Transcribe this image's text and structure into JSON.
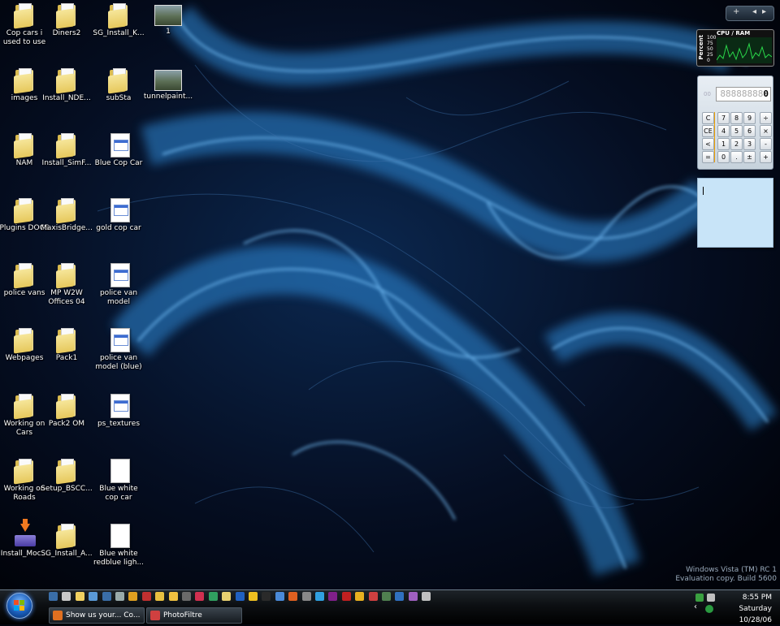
{
  "desktop": {
    "icons": [
      {
        "label": "Cop cars i used to use",
        "type": "folder"
      },
      {
        "label": "Diners2",
        "type": "folder"
      },
      {
        "label": "SG_Install_K...",
        "type": "folder"
      },
      {
        "label": "1",
        "type": "thumb"
      },
      {
        "label": "images",
        "type": "folder"
      },
      {
        "label": "Install_NDE...",
        "type": "folder"
      },
      {
        "label": "subSta",
        "type": "folder"
      },
      {
        "label": "tunnelpaint...",
        "type": "thumb"
      },
      {
        "label": "NAM",
        "type": "folder"
      },
      {
        "label": "Install_SimF...",
        "type": "folder"
      },
      {
        "label": "Blue Cop Car",
        "type": "doc"
      },
      {
        "label": "Plugins DOCS",
        "type": "folder"
      },
      {
        "label": "MaxisBridge...",
        "type": "folder"
      },
      {
        "label": "gold cop car",
        "type": "doc"
      },
      {
        "label": "police vans",
        "type": "folder"
      },
      {
        "label": "MP W2W Offices 04",
        "type": "folder"
      },
      {
        "label": "police van model",
        "type": "doc"
      },
      {
        "label": "Webpages",
        "type": "folder"
      },
      {
        "label": "Pack1",
        "type": "folder"
      },
      {
        "label": "police van model (blue)",
        "type": "doc"
      },
      {
        "label": "Working on Cars",
        "type": "folder"
      },
      {
        "label": "Pack2 OM",
        "type": "folder"
      },
      {
        "label": "ps_textures",
        "type": "doc"
      },
      {
        "label": "Working on Roads",
        "type": "folder"
      },
      {
        "label": "Setup_BSCC...",
        "type": "folder"
      },
      {
        "label": "Blue white cop car",
        "type": "blank"
      },
      {
        "label": "Install_Moc...",
        "type": "install"
      },
      {
        "label": "SG_Install_A...",
        "type": "folder"
      },
      {
        "label": "Blue white redblue ligh...",
        "type": "blank"
      }
    ]
  },
  "sidebar": {
    "toolbar": {
      "add_label": "+",
      "prev_label": "◂",
      "next_label": "▸"
    },
    "cpu_gadget": {
      "title": "CPU / RAM",
      "axis_label": "Percent",
      "scale": [
        "100",
        "75",
        "50",
        "25",
        "0"
      ],
      "graph_color": "#2ad84a"
    },
    "calculator": {
      "display_dim": "88888888",
      "display_value": "0",
      "memory_label": "00",
      "keys": [
        "C",
        "7",
        "8",
        "9",
        "÷",
        "CE",
        "4",
        "5",
        "6",
        "×",
        "<",
        "1",
        "2",
        "3",
        "-",
        "=",
        "0",
        ".",
        "±",
        "+"
      ]
    },
    "notes": {
      "text": ""
    }
  },
  "watermark": {
    "line1": "Windows Vista (TM) RC 1",
    "line2": "Evaluation copy. Build 5600"
  },
  "taskbar": {
    "quick_launch_icon_colors": [
      "#3a6ea8",
      "#c8c8c8",
      "#f0d060",
      "#5a9ad8",
      "#3a6ea8",
      "#9aa",
      "#e0a020",
      "#c03030",
      "#e8c040",
      "#f0c040",
      "#6a6a6a",
      "#d03050",
      "#30a060",
      "#e8d070",
      "#2060c0",
      "#f0c020",
      "#2a2a2a",
      "#4a8ad8",
      "#e06020",
      "#888888",
      "#30a0e0",
      "#80208a",
      "#c02020",
      "#e8b020",
      "#d04040",
      "#508050",
      "#3070c0",
      "#a060c0",
      "#c0c0c0"
    ],
    "tasks": [
      {
        "label": "Show us your... Co...",
        "icon_color": "#e07020"
      },
      {
        "label": "PhotoFiltre",
        "icon_color": "#d04040"
      }
    ],
    "clock": {
      "time": "8:55 PM",
      "day": "Saturday",
      "date": "10/28/06"
    },
    "accent": "#4a90ff"
  }
}
